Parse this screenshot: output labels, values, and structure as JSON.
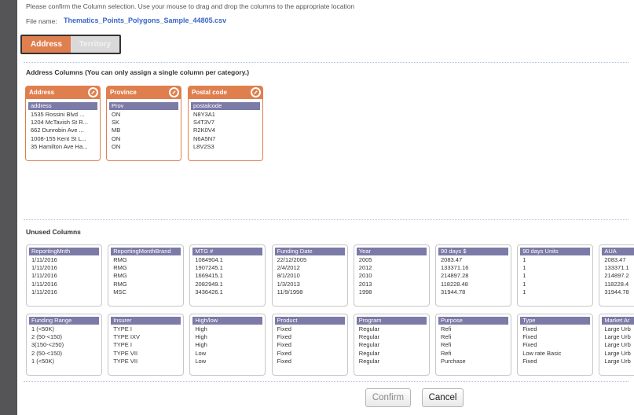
{
  "instructions": "Please confirm the Column selection. Use your mouse to drag and drop the columns to the appropriate location",
  "file": {
    "label": "File name:",
    "name": "Thematics_Points_Polygons_Sample_44805.csv"
  },
  "tabs": [
    {
      "label": "Address"
    },
    {
      "label": "Territory"
    }
  ],
  "address_section": {
    "title": "Address Columns (You can only assign a single column per category.)",
    "categories": [
      {
        "label": "Address",
        "column": {
          "header": "address",
          "values": [
            "1535 Rossini Blvd ...",
            "1204 McTavish St R...",
            "662 Dunrobin Ave ...",
            "1008-155 Kent St L...",
            "35 Hamilton Ave Ha..."
          ]
        }
      },
      {
        "label": "Province",
        "column": {
          "header": "Prov",
          "values": [
            "ON",
            "SK",
            "MB",
            "ON",
            "ON"
          ]
        }
      },
      {
        "label": "Postal code",
        "column": {
          "header": "postalcode",
          "values": [
            "N8Y3A1",
            "S4T3V7",
            "R2K0V4",
            "N6A5N7",
            "L8V2S3"
          ]
        }
      }
    ]
  },
  "unused_section": {
    "title": "Unused Columns",
    "columns": [
      {
        "header": "ReportingMnth",
        "values": [
          "1/11/2016",
          "1/11/2016",
          "1/11/2016",
          "1/11/2016",
          "1/11/2016"
        ]
      },
      {
        "header": "ReportingMonthBrand",
        "values": [
          "RMG",
          "RMG",
          "RMG",
          "RMG",
          "MSC"
        ]
      },
      {
        "header": "MTG #",
        "values": [
          "1084904.1",
          "1907245.1",
          "1669415.1",
          "2082949.1",
          "3436426.1"
        ]
      },
      {
        "header": "Funding Date",
        "values": [
          "22/12/2005",
          "2/4/2012",
          "8/1/2010",
          "1/3/2013",
          "11/9/1998"
        ]
      },
      {
        "header": "Year",
        "values": [
          "2005",
          "2012",
          "2010",
          "2013",
          "1998"
        ]
      },
      {
        "header": "90 days $",
        "values": [
          "2083.47",
          "133371.16",
          "214897.28",
          "118228.48",
          "31944.78"
        ]
      },
      {
        "header": "90 days Units",
        "values": [
          "1",
          "1",
          "1",
          "1",
          "1"
        ]
      },
      {
        "header": "AUA",
        "values": [
          "2083.47",
          "133371.1",
          "214897.2",
          "118228.4",
          "31944.78"
        ]
      },
      {
        "header": "Funding Range",
        "values": [
          "1 (<50K)",
          "2 (50-<150)",
          "3(150-<250)",
          "2 (50-<150)",
          "1 (<50K)"
        ]
      },
      {
        "header": "Insurer",
        "values": [
          "TYPE I",
          "TYPE IXV",
          "TYPE I",
          "TYPE VII",
          "TYPE VII"
        ]
      },
      {
        "header": "High/low",
        "values": [
          "High",
          "High",
          "High",
          "Low",
          "Low"
        ]
      },
      {
        "header": "Product",
        "values": [
          "Fixed",
          "Fixed",
          "Fixed",
          "Fixed",
          "Fixed"
        ]
      },
      {
        "header": "Program",
        "values": [
          "Regular",
          "Regular",
          "Regular",
          "Regular",
          "Regular"
        ]
      },
      {
        "header": "Purpose",
        "values": [
          "Refi",
          "Refi",
          "Refi",
          "Refi",
          "Purchase"
        ]
      },
      {
        "header": "Type",
        "values": [
          "Fixed",
          "Fixed",
          "Fixed",
          "Low rate Basic",
          "Fixed"
        ]
      },
      {
        "header": "Market Ar",
        "values": [
          "Large Urb",
          "Large Urb",
          "Large Urb",
          "Large Urb",
          "Large Urb"
        ]
      }
    ]
  },
  "buttons": {
    "confirm": "Confirm",
    "cancel": "Cancel"
  },
  "colors": {
    "accent": "#e07f4e",
    "column_header": "#7c7aa6",
    "link": "#3a66c8"
  },
  "icons": {
    "edit": "pencil-icon"
  }
}
